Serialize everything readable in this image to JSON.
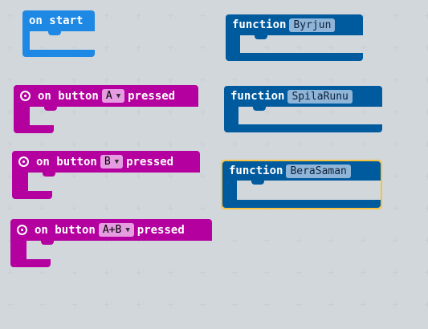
{
  "colors": {
    "workspace": "#eceff1",
    "on_start": "#1e88e5",
    "input_events": "#b4009e",
    "functions": "#005a9e",
    "selection": "#f6c23e"
  },
  "on_start": {
    "label": "on start"
  },
  "button_events": [
    {
      "prefix": "on button",
      "button": "A",
      "suffix": "pressed"
    },
    {
      "prefix": "on button",
      "button": "B",
      "suffix": "pressed"
    },
    {
      "prefix": "on button",
      "button": "A+B",
      "suffix": "pressed"
    }
  ],
  "functions": [
    {
      "keyword": "function",
      "name": "Byrjun"
    },
    {
      "keyword": "function",
      "name": "SpilaRunu"
    },
    {
      "keyword": "function",
      "name": "BeraSaman",
      "selected": true
    }
  ],
  "icons": {
    "event": "button-event-icon",
    "dropdown": "dropdown-caret-icon"
  }
}
